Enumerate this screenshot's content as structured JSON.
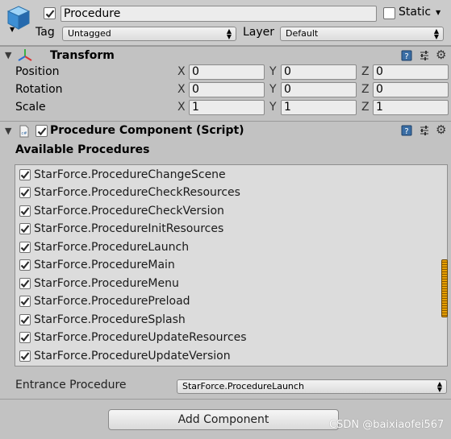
{
  "header": {
    "active": true,
    "name_value": "Procedure",
    "static_label": "Static",
    "static_checked": false,
    "tag_label": "Tag",
    "tag_value": "Untagged",
    "layer_label": "Layer",
    "layer_value": "Default"
  },
  "transform": {
    "title": "Transform",
    "rows": [
      {
        "label": "Position",
        "x": "0",
        "y": "0",
        "z": "0"
      },
      {
        "label": "Rotation",
        "x": "0",
        "y": "0",
        "z": "0"
      },
      {
        "label": "Scale",
        "x": "1",
        "y": "1",
        "z": "1"
      }
    ],
    "axis_x": "X",
    "axis_y": "Y",
    "axis_z": "Z"
  },
  "procedure_component": {
    "title": "Procedure Component (Script)",
    "enabled": true,
    "available_label": "Available Procedures",
    "procedures": [
      {
        "name": "StarForce.ProcedureChangeScene",
        "checked": true
      },
      {
        "name": "StarForce.ProcedureCheckResources",
        "checked": true
      },
      {
        "name": "StarForce.ProcedureCheckVersion",
        "checked": true
      },
      {
        "name": "StarForce.ProcedureInitResources",
        "checked": true
      },
      {
        "name": "StarForce.ProcedureLaunch",
        "checked": true
      },
      {
        "name": "StarForce.ProcedureMain",
        "checked": true
      },
      {
        "name": "StarForce.ProcedureMenu",
        "checked": true
      },
      {
        "name": "StarForce.ProcedurePreload",
        "checked": true
      },
      {
        "name": "StarForce.ProcedureSplash",
        "checked": true
      },
      {
        "name": "StarForce.ProcedureUpdateResources",
        "checked": true
      },
      {
        "name": "StarForce.ProcedureUpdateVersion",
        "checked": true
      }
    ],
    "entrance_label": "Entrance Procedure",
    "entrance_value": "StarForce.ProcedureLaunch"
  },
  "add_component_label": "Add Component",
  "watermark": "CSDN @baixiaofei567",
  "colors": {
    "scroll_thumb": "#e8a000",
    "check": "#2b2b2b"
  },
  "icons": [
    "gameobject-cube-icon",
    "transform-axes-icon",
    "script-icon",
    "help-book-icon",
    "preset-sliders-icon",
    "gear-icon"
  ]
}
